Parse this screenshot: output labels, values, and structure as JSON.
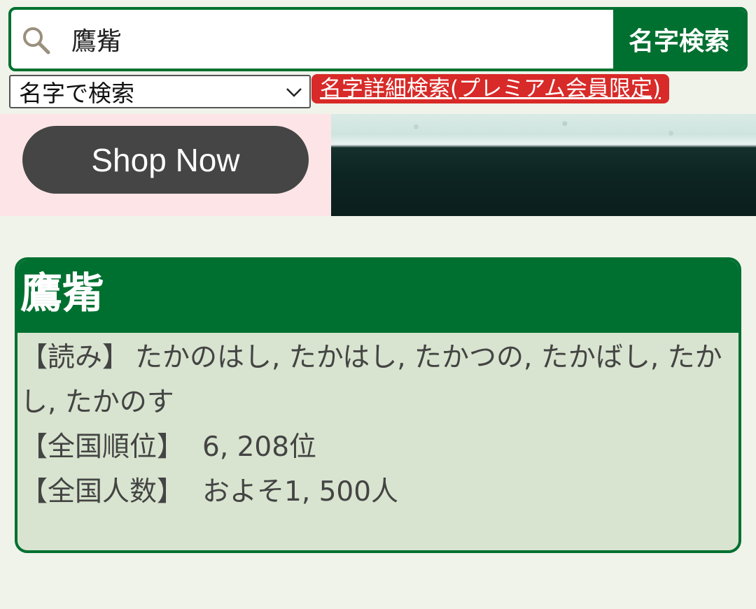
{
  "search": {
    "query": "鷹觜",
    "button_label": "名字検索"
  },
  "mode_select": {
    "selected": "名字で検索"
  },
  "premium_link": {
    "label": "名字詳細検索(プレミアム会員限定)"
  },
  "ad": {
    "button_label": "Shop Now"
  },
  "result": {
    "title": "鷹觜",
    "readings_label": "【読み】",
    "readings": "たかのはし, たかはし, たかつの, たかばし, たかし, たかのす",
    "rank_label": "【全国順位】",
    "rank": "6, 208位",
    "count_label": "【全国人数】",
    "count": "およそ1, 500人"
  },
  "colors": {
    "brand_green": "#007030",
    "premium_red": "#d82a28",
    "card_body": "#d8e4cf",
    "page_bg": "#f0f3ea",
    "ad_bg": "#fde5e7"
  },
  "icons": {
    "search": "search-icon",
    "select_caret": "chevron-down-icon"
  }
}
